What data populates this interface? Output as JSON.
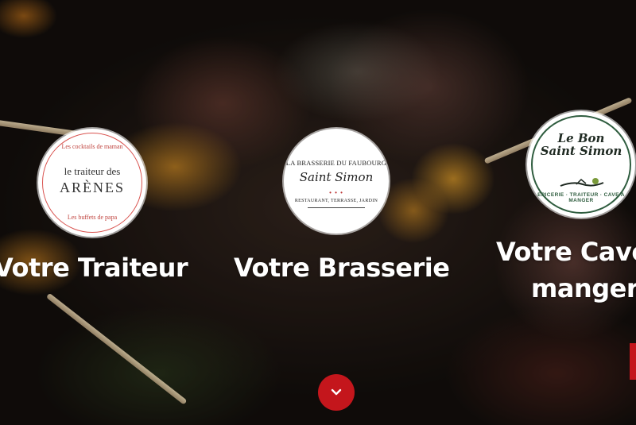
{
  "hero": {
    "cards": [
      {
        "logo": {
          "top_text": "Les cocktails de maman",
          "line1": "le traiteur des",
          "line2": "ARÈNES",
          "bottom_text": "Les buffets de papa"
        },
        "caption": "Votre Traiteur"
      },
      {
        "logo": {
          "line1": "LA BRASSERIE DU FAUBOURG",
          "line2": "Saint Simon",
          "line3": "RESTAURANT, TERRASSE, JARDIN"
        },
        "caption": "Votre Brasserie"
      },
      {
        "logo": {
          "line1": "Le Bon",
          "line2": "Saint Simon",
          "arc_text": "EPICERIE · TRAITEUR · CAVE A MANGER"
        },
        "caption_line1": "Votre Cave",
        "caption_line2": "manger"
      }
    ]
  },
  "icons": {
    "scroll_down": "chevron-down-icon"
  },
  "colors": {
    "accent": "#c4161c",
    "caption_text": "#ffffff"
  }
}
